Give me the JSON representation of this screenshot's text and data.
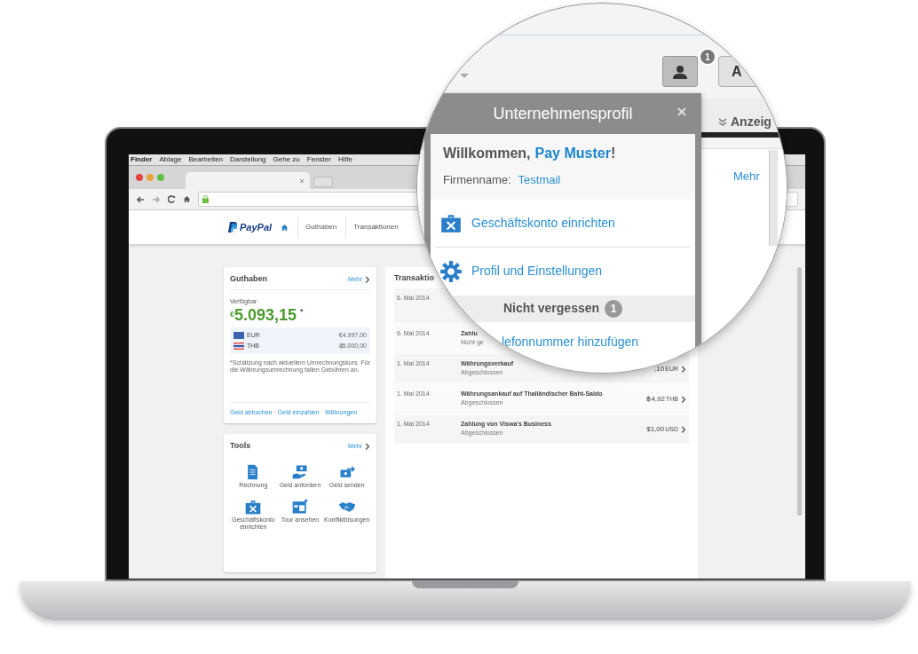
{
  "menu_bar": [
    "Finder",
    "Ablage",
    "Bearbeiten",
    "Darstellung",
    "Gehe zu",
    "Fenster",
    "Hilfe"
  ],
  "header": {
    "logo": "PayPal",
    "nav": [
      "Guthaben",
      "Transaktionen"
    ]
  },
  "balance": {
    "title": "Guthaben",
    "more": "Mehr",
    "label": "Verfügbar",
    "symbol": "€",
    "amount": "5.093,15",
    "mark": "*",
    "currencies": [
      {
        "code": "EUR",
        "amount": "€4.997,00",
        "kind": "eu"
      },
      {
        "code": "THB",
        "amount": "฿5.000,00",
        "kind": "th"
      }
    ],
    "note": "*Schätzung nach aktuellem Umrechnungskurs. Für die Währungsumrechnung fallen Gebühren an.",
    "links": [
      "Geld abbuchen",
      "Geld einzahlen",
      "Währungen"
    ],
    "separator": "·"
  },
  "tools": {
    "title": "Tools",
    "more": "Mehr",
    "items": [
      {
        "kind": "invoice",
        "label": "Rechnung"
      },
      {
        "kind": "request",
        "label": "Geld anfordern"
      },
      {
        "kind": "send",
        "label": "Geld senden"
      },
      {
        "kind": "briefcase",
        "label": "Geschäftskonto einrichten"
      },
      {
        "kind": "tour",
        "label": "Tour ansehen"
      },
      {
        "kind": "handshake",
        "label": "Konfliktlösungen"
      }
    ]
  },
  "transactions": {
    "title": "Transaktio",
    "rows": [
      {
        "date": "6. Mai 2014"
      },
      {
        "date": "6. Mai 2014",
        "title": "Zahlu",
        "status": "Nicht ge"
      },
      {
        "date": "1. Mai 2014",
        "title": "Währungsverkauf",
        "status": "Abgeschlossen",
        "amount": ",10",
        "currency": "EUR"
      },
      {
        "date": "1. Mai 2014",
        "title": "Währungsankauf auf Thailändischer Baht-Saldo",
        "status": "Abgeschlossen",
        "amount": "฿4,92",
        "currency": "THB"
      },
      {
        "date": "1. Mai 2014",
        "title": "Zahlung von Viswa's Business",
        "status": "Abgeschlossen",
        "amount": "$1,00",
        "currency": "USD"
      }
    ]
  },
  "magnifier": {
    "badge": "1",
    "button": "A",
    "toolbar_label": "Anzeig",
    "more": "Mehr",
    "dropdown": {
      "title": "Unternehmensprofil",
      "welcome": "Willkommen,",
      "name": "Pay Muster",
      "suffix": "!",
      "company_label": "Firmenname:",
      "company": "Testmail",
      "items": [
        {
          "kind": "briefcase",
          "label": "Geschäftskonto einrichten"
        },
        {
          "kind": "gear",
          "label": "Profil und Einstellungen"
        }
      ],
      "reminder": {
        "title": "Nicht vergessen",
        "count": "1",
        "items": [
          "lefonnummer hinzufügen"
        ]
      }
    }
  }
}
